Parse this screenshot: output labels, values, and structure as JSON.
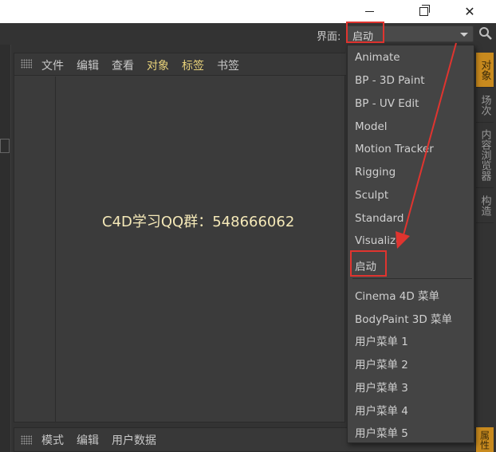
{
  "window_controls": {
    "minimize_icon": "minimize-icon",
    "maximize_icon": "restore-icon",
    "close_glyph": "✕"
  },
  "layout_switch": {
    "label": "界面:",
    "selected": "启动",
    "arrow_icon": "triangle-down-icon",
    "search_icon": "search-icon"
  },
  "object_panel": {
    "menu": [
      "文件",
      "编辑",
      "查看",
      "对象",
      "标签",
      "书签"
    ],
    "highlighted_menu": [
      "对象",
      "标签"
    ],
    "watermark": "C4D学习QQ群：548666062"
  },
  "right_tabs": [
    "对象",
    "场次",
    "内容浏览器",
    "构造"
  ],
  "attribute_panel": {
    "menu": [
      "模式",
      "编辑",
      "用户数据"
    ],
    "side_tab": "属性"
  },
  "layout_menu": {
    "group1": [
      "Animate",
      "BP - 3D Paint",
      "BP - UV Edit",
      "Model",
      "Motion Tracker",
      "Rigging",
      "Sculpt",
      "Standard",
      "Visualize"
    ],
    "current": "启动",
    "group2": [
      "Cinema 4D 菜单",
      "BodyPaint 3D 菜单",
      "用户菜单 1",
      "用户菜单 2",
      "用户菜单 3",
      "用户菜单 4",
      "用户菜单 5"
    ]
  },
  "colors": {
    "annotation_red": "#e0342f",
    "accent_orange": "#c88a1e",
    "highlight_text": "#e8d27a"
  }
}
